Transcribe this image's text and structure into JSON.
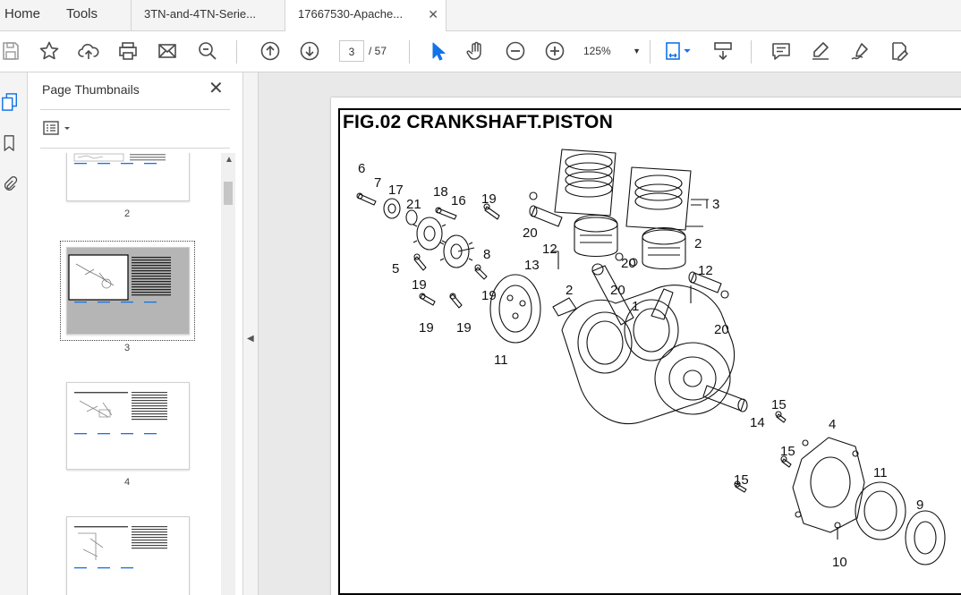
{
  "menu": {
    "home": "Home",
    "tools": "Tools"
  },
  "tabs": [
    {
      "label": "3TN-and-4TN-Serie..."
    },
    {
      "label": "17667530-Apache...",
      "close": "✕"
    }
  ],
  "toolbar": {
    "current_page": "3",
    "total_pages": "/ 57",
    "zoom": "125%",
    "icons": [
      "save-icon",
      "bookmark-star-icon",
      "upload-icon",
      "print-icon",
      "email-icon",
      "find-icon",
      "previous-page-icon",
      "next-page-icon",
      "select-cursor-icon",
      "hand-icon",
      "zoom-out-icon",
      "zoom-in-icon",
      "page-fit-icon",
      "scroll-mode-icon",
      "comment-icon",
      "highlight-icon",
      "sign-icon",
      "edit-pdf-icon"
    ]
  },
  "panel": {
    "title": "Page Thumbnails",
    "close": "✕",
    "thumbnails": [
      {
        "label": "2"
      },
      {
        "label": "3",
        "selected": true
      },
      {
        "label": "4"
      },
      {
        "label": ""
      }
    ]
  },
  "document": {
    "figure_title": "FIG.02 CRANKSHAFT.PISTON",
    "callouts": [
      "6",
      "7",
      "17",
      "21",
      "18",
      "16",
      "19",
      "20",
      "12",
      "3",
      "5",
      "8",
      "19",
      "13",
      "19",
      "2",
      "2",
      "20",
      "20",
      "12",
      "19",
      "19",
      "11",
      "1",
      "20",
      "15",
      "14",
      "4",
      "15",
      "15",
      "11",
      "9",
      "10"
    ]
  },
  "colors": {
    "accent": "#1473e6",
    "icon": "#4b4b4b"
  }
}
